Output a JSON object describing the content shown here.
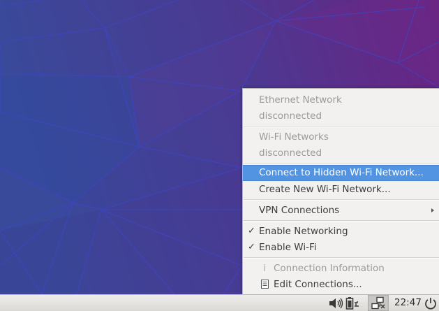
{
  "menu": {
    "ethernet_header": "Ethernet Network",
    "ethernet_status": "disconnected",
    "wifi_header": "Wi-Fi Networks",
    "wifi_status": "disconnected",
    "connect_hidden": "Connect to Hidden Wi-Fi Network...",
    "create_new": "Create New Wi-Fi Network...",
    "vpn": "VPN Connections",
    "enable_networking": "Enable Networking",
    "enable_wifi": "Enable Wi-Fi",
    "connection_info": "Connection Information",
    "edit_connections": "Edit Connections...",
    "check_glyph": "✓",
    "info_glyph": "i"
  },
  "panel": {
    "clock": "22:47",
    "icons": [
      "volume-icon",
      "battery-icon",
      "network-icon",
      "power-icon"
    ]
  },
  "colors": {
    "menu_bg": "#f2f1f0",
    "highlight": "#5294e2",
    "wallpaper_blue": "#3a4a9a",
    "wallpaper_purple": "#6a2480"
  }
}
